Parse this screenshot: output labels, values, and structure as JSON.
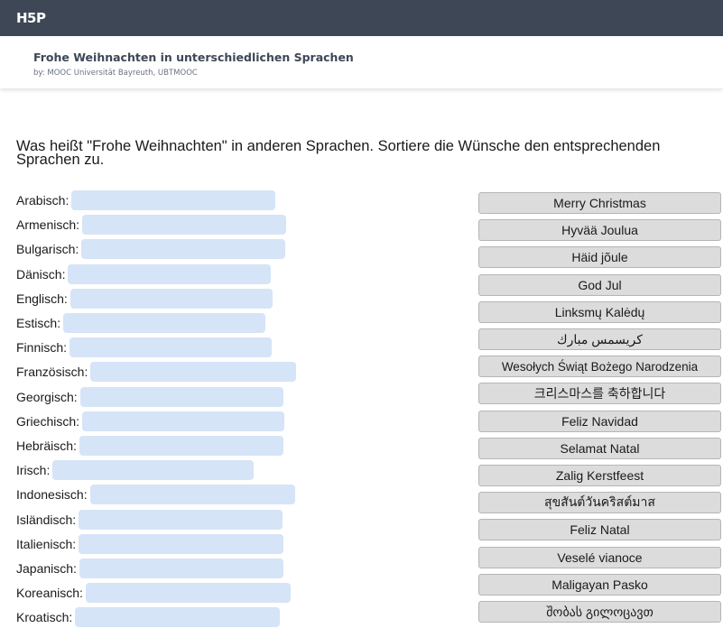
{
  "brand": {
    "logo_text": "H5P"
  },
  "header": {
    "title": "Frohe Weihnachten in unterschiedlichen Sprachen",
    "byline": "by: MOOC Universität Bayreuth, UBTMOOC"
  },
  "question": "Was heißt \"Frohe Weihnachten\" in anderen Sprachen. Sortiere die Wünsche den entsprechenden Sprachen zu.",
  "languages": [
    "Arabisch:",
    "Armenisch:",
    "Bulgarisch:",
    "Dänisch:",
    "Englisch:",
    "Estisch:",
    "Finnisch:",
    "Französisch:",
    "Georgisch:",
    "Griechisch:",
    "Hebräisch:",
    "Irisch:",
    "Indonesisch:",
    "Isländisch:",
    "Italienisch:",
    "Japanisch:",
    "Koreanisch:",
    "Kroatisch:"
  ],
  "greetings": [
    "Merry Christmas",
    "Hyvää Joulua",
    "Häid jõule",
    "God Jul",
    "Linksmų Kalėdų",
    "كريسمس مبارك",
    "Wesołych Świąt Bożego Narodzenia",
    "크리스마스를 축하합니다",
    "Feliz Navidad",
    "Selamat Natal",
    "Zalig Kerstfeest",
    "สุขสันต์วันคริสต์มาส",
    "Feliz Natal",
    "Veselé vianoce",
    "Maligayan Pasko",
    "შობას გილოცავთ"
  ]
}
